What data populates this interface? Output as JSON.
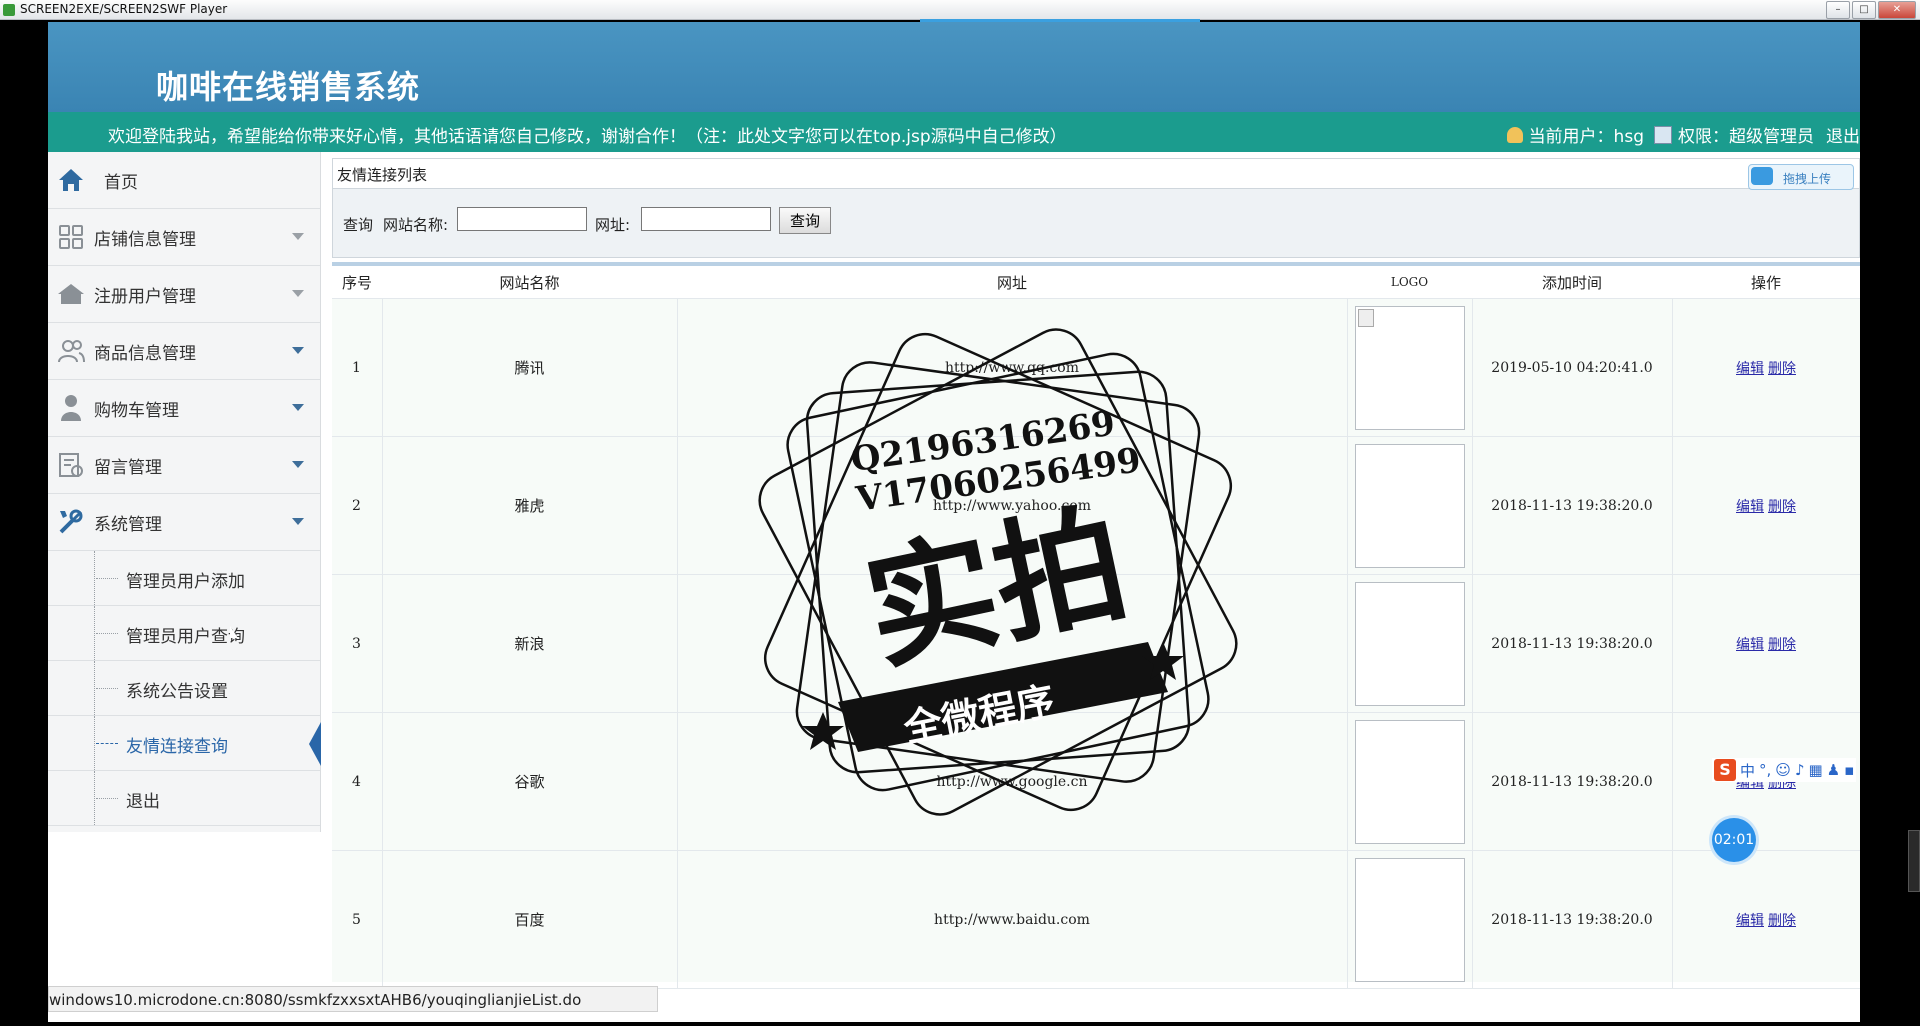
{
  "window": {
    "title": "SCREEN2EXE/SCREEN2SWF Player"
  },
  "header": {
    "system_title": "咖啡在线销售系统"
  },
  "welcome": {
    "message": "欢迎登陆我站，希望能给你带来好心情，其他话语请您自己修改，谢谢合作！（注：此处文字您可以在top.jsp源码中自己修改）",
    "current_user_label": "当前用户：hsg",
    "role_label": "权限：超级管理员",
    "logout": "退出"
  },
  "sidebar": {
    "items": [
      {
        "label": "首页",
        "icon": "home-icon"
      },
      {
        "label": "店铺信息管理",
        "icon": "grid-icon"
      },
      {
        "label": "注册用户管理",
        "icon": "house-icon"
      },
      {
        "label": "商品信息管理",
        "icon": "users-icon"
      },
      {
        "label": "购物车管理",
        "icon": "person-icon"
      },
      {
        "label": "留言管理",
        "icon": "message-icon"
      },
      {
        "label": "系统管理",
        "icon": "tools-icon"
      }
    ],
    "sub_items": [
      {
        "label": "管理员用户添加"
      },
      {
        "label": "管理员用户查询"
      },
      {
        "label": "系统公告设置"
      },
      {
        "label": "友情连接查询"
      },
      {
        "label": "退出"
      }
    ]
  },
  "panel": {
    "title": "友情连接列表"
  },
  "search": {
    "query_label": "查询",
    "name_label": "网站名称:",
    "name_value": "",
    "url_label": "网址:",
    "url_value": "",
    "button": "查询"
  },
  "table": {
    "headers": [
      "序号",
      "网站名称",
      "网址",
      "LOGO",
      "添加时间",
      "操作"
    ],
    "rows": [
      {
        "idx": "1",
        "name": "腾讯",
        "url": "http://www.qq.com",
        "time": "2019-05-10 04:20:41.0",
        "edit": "编辑",
        "delete": "删除"
      },
      {
        "idx": "2",
        "name": "雅虎",
        "url": "http://www.yahoo.com",
        "time": "2018-11-13 19:38:20.0",
        "edit": "编辑",
        "delete": "删除"
      },
      {
        "idx": "3",
        "name": "新浪",
        "url": "",
        "time": "2018-11-13 19:38:20.0",
        "edit": "编辑",
        "delete": "删除"
      },
      {
        "idx": "4",
        "name": "谷歌",
        "url": "http://www.google.cn",
        "time": "2018-11-13 19:38:20.0",
        "edit": "编辑",
        "delete": "删除"
      },
      {
        "idx": "5",
        "name": "百度",
        "url": "http://www.baidu.com",
        "time": "2018-11-13 19:38:20.0",
        "edit": "编辑",
        "delete": "删除"
      }
    ]
  },
  "status_bar": {
    "url": "windows10.microdone.cn:8080/ssmkfzxxsxtAHB6/youqinglianjieList.do"
  },
  "upload_widget": {
    "label": "拖拽上传"
  },
  "ime": {
    "brand": "S",
    "mode": "中"
  },
  "timer": {
    "value": "02:01"
  },
  "watermark": {
    "line1": "Q2196316269",
    "line2": "V17060256499",
    "big": "实拍",
    "ribbon": "全微程序"
  },
  "colors": {
    "header": "#3a84b3",
    "welcome_bar": "#1b9c8e",
    "link": "#2a2aa8",
    "active_nav": "#2a66a8"
  }
}
